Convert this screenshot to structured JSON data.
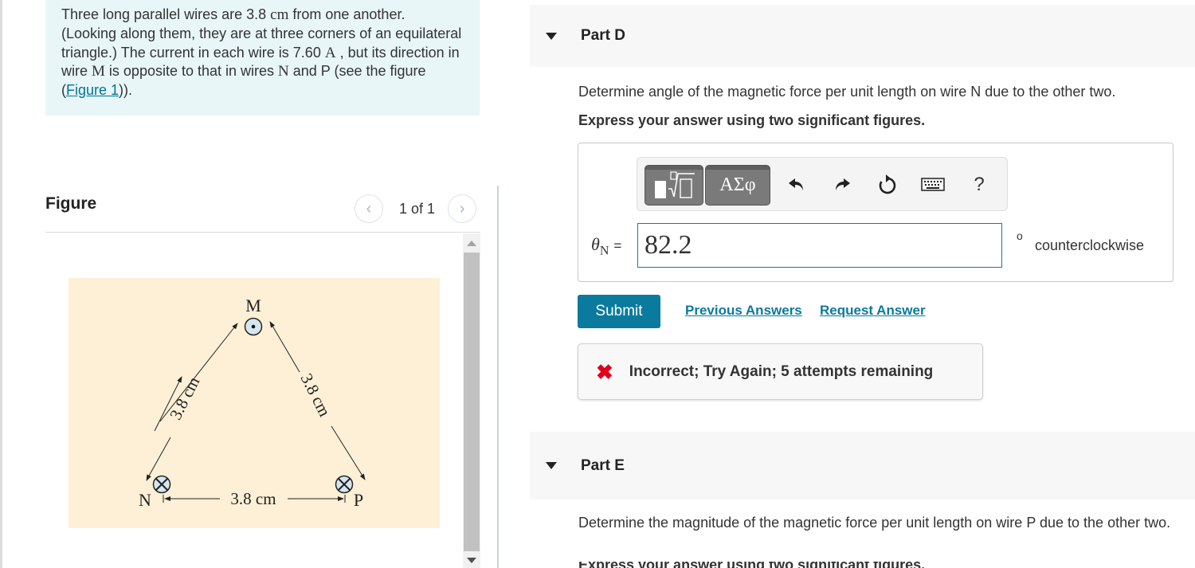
{
  "problem": {
    "intro_parts": {
      "p1": "Three long parallel wires are 3.8 ",
      "unit_cm": "cm",
      "p2": " from one another. (Looking along them, they are at three corners of an equilateral triangle.) The current in each wire is 7.60 ",
      "unit_A": "A",
      "p3": " , but its direction in wire ",
      "wire_M": "M",
      "p4": " is opposite to that in wires ",
      "wire_N": "N",
      "p5": " and P (see the figure (",
      "figure_link": "Figure 1",
      "p6": "))."
    }
  },
  "figure": {
    "title": "Figure",
    "pager": {
      "current_label": "1 of 1",
      "prev_icon": "chevron-left",
      "next_icon": "chevron-right"
    },
    "labels": {
      "M": "M",
      "N": "N",
      "P": "P",
      "side_left": "3.8 cm",
      "side_right": "3.8 cm",
      "side_bottom": "3.8 cm"
    },
    "wires": {
      "M": "out-of-page",
      "N": "into-page",
      "P": "into-page"
    },
    "colors": {
      "background": "#fef0d6",
      "wire_fill": "#d6e6ee"
    }
  },
  "part_d": {
    "title": "Part D",
    "question": "Determine angle of the magnetic force per unit length on wire N due to the other two.",
    "instruction": "Express your answer using two significant figures.",
    "toolbar": {
      "template_icon": "fraction-root-template",
      "greek_label": "ΑΣφ",
      "undo_icon": "undo",
      "redo_icon": "redo",
      "reset_icon": "reset",
      "keyboard_icon": "keyboard",
      "help_label": "?"
    },
    "answer": {
      "label_symbol": "θ",
      "label_sub": "N",
      "equals": "=",
      "value": "82.2",
      "degree": "o",
      "unit": "counterclockwise"
    },
    "submit_label": "Submit",
    "previous_answers_label": "Previous Answers",
    "request_answer_label": "Request Answer",
    "feedback": {
      "message": "Incorrect; Try Again; 5 attempts remaining",
      "icon": "x-mark",
      "color": "#e0001a"
    }
  },
  "part_e": {
    "title": "Part E",
    "question": "Determine the magnitude of the magnetic force per unit length on wire P due to the other two.",
    "instruction_partial": "Express your answer using two significant figures."
  },
  "colors": {
    "accent": "#0a7a9e",
    "intro_bg": "#e8f6f8",
    "part_header_bg": "#f7f7f7"
  }
}
